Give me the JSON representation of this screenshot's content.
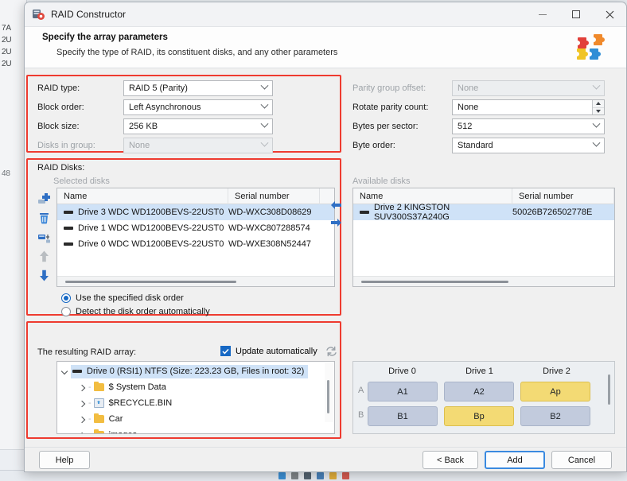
{
  "window": {
    "title": "RAID Constructor",
    "app_icon": "raid-constructor-icon",
    "minimize": "minimize-icon",
    "maximize": "maximize-icon",
    "close": "close-icon"
  },
  "header": {
    "title": "Specify the array parameters",
    "subtitle": "Specify the type of RAID, its constituent disks, and any other parameters",
    "logo": "puzzle-pieces-icon"
  },
  "parameters": {
    "left": [
      {
        "label": "RAID type:",
        "value": "RAID 5 (Parity)",
        "control": "combo",
        "disabled": false
      },
      {
        "label": "Block order:",
        "value": "Left Asynchronous",
        "control": "combo",
        "disabled": false
      },
      {
        "label": "Block size:",
        "value": "256 KB",
        "control": "combo",
        "disabled": false
      },
      {
        "label": "Disks in group:",
        "value": "None",
        "control": "combo",
        "disabled": true
      }
    ],
    "right": [
      {
        "label": "Parity group offset:",
        "value": "None",
        "control": "combo",
        "disabled": true
      },
      {
        "label": "Rotate parity count:",
        "value": "None",
        "control": "spinner",
        "disabled": false
      },
      {
        "label": "Bytes per sector:",
        "value": "512",
        "control": "combo",
        "disabled": false
      },
      {
        "label": "Byte order:",
        "value": "Standard",
        "control": "combo",
        "disabled": false
      }
    ]
  },
  "raid_disks": {
    "section_label": "RAID Disks:",
    "selected_label": "Selected disks",
    "available_label": "Available disks",
    "columns": [
      "Name",
      "Serial number"
    ],
    "selected": [
      {
        "name": "Drive 3 WDC WD1200BEVS-22UST0",
        "serial": "WD-WXC308D08629",
        "selected": true
      },
      {
        "name": "Drive 1 WDC WD1200BEVS-22UST0",
        "serial": "WD-WXC807288574",
        "selected": false
      },
      {
        "name": "Drive 0 WDC WD1200BEVS-22UST0",
        "serial": "WD-WXE308N52447",
        "selected": false
      }
    ],
    "available": [
      {
        "name": "Drive 2 KINGSTON SUV300S37A240G",
        "serial": "50026B726502778E",
        "selected": true
      }
    ],
    "toolbar": [
      {
        "icon": "add-disk-icon",
        "enabled": true
      },
      {
        "icon": "delete-disk-icon",
        "enabled": true
      },
      {
        "icon": "clone-disk-icon",
        "enabled": true
      },
      {
        "icon": "move-up-icon",
        "enabled": false
      },
      {
        "icon": "move-down-icon",
        "enabled": true
      }
    ],
    "transfer": [
      {
        "icon": "move-left-icon"
      },
      {
        "icon": "move-right-icon"
      }
    ],
    "order_options": [
      {
        "label": "Use the specified disk order",
        "selected": true
      },
      {
        "label": "Detect the disk order automatically",
        "selected": false
      }
    ]
  },
  "result": {
    "label": "The resulting RAID array:",
    "update_checkbox": {
      "label": "Update automatically",
      "checked": true
    },
    "refresh_icon": "refresh-icon",
    "tree": [
      {
        "label": "Drive 0 (RSI1) NTFS (Size: 223.23 GB, Files in root: 32)",
        "icon": "disk-icon",
        "expanded": true,
        "selected": true,
        "depth": 0
      },
      {
        "label": "$ System Data",
        "icon": "folder-icon",
        "expanded": false,
        "selected": false,
        "depth": 1
      },
      {
        "label": "$RECYCLE.BIN",
        "icon": "recycle-bin-icon",
        "expanded": false,
        "selected": false,
        "depth": 1
      },
      {
        "label": "Car",
        "icon": "folder-icon",
        "expanded": false,
        "selected": false,
        "depth": 1
      },
      {
        "label": "images",
        "icon": "folder-icon",
        "expanded": false,
        "selected": false,
        "depth": 1
      }
    ]
  },
  "layout_map": {
    "drive_headers": [
      "Drive 0",
      "Drive 1",
      "Drive 2"
    ],
    "row_labels": [
      "A",
      "B"
    ],
    "cells": [
      [
        {
          "label": "A1",
          "kind": "data"
        },
        {
          "label": "A2",
          "kind": "data"
        },
        {
          "label": "Ap",
          "kind": "parity"
        }
      ],
      [
        {
          "label": "B1",
          "kind": "data"
        },
        {
          "label": "Bp",
          "kind": "parity"
        },
        {
          "label": "B2",
          "kind": "data"
        }
      ]
    ]
  },
  "footer": {
    "help": "Help",
    "back": "< Back",
    "add": "Add",
    "cancel": "Cancel"
  },
  "background_fragments": [
    "7A",
    "2U",
    "2U",
    "2U",
    "48"
  ],
  "colors": {
    "highlight_box": "#ee3b30",
    "selection": "#cfe2f7",
    "accent": "#1668c4",
    "parity": "#f3da74",
    "data_block": "#c2cbdd"
  }
}
